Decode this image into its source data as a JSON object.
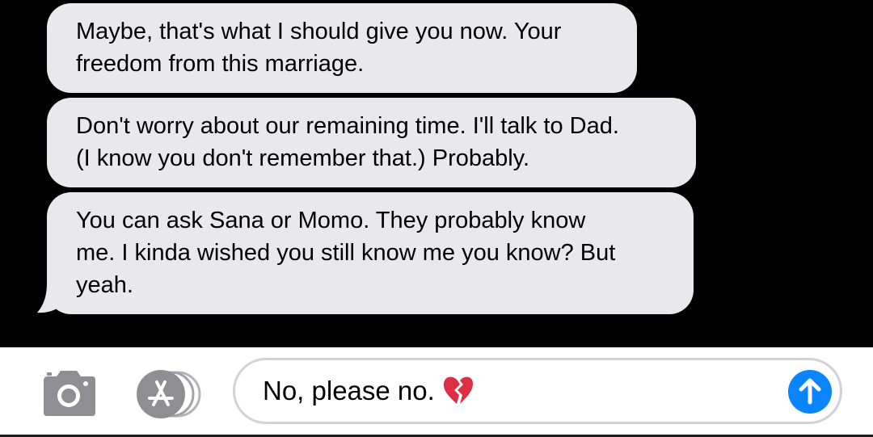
{
  "thread": {
    "messages": [
      {
        "sender": "received",
        "text": "Maybe, that's what I should give you now. Your\nfreedom from this marriage."
      },
      {
        "sender": "received",
        "text": "Don't worry about our remaining time. I'll talk to Dad.\n(I know you don't remember that.) Probably."
      },
      {
        "sender": "received",
        "text": "You can ask Sana or Momo. They probably know\nme. I kinda wished you still know me you know? But\nyeah."
      }
    ]
  },
  "input_bar": {
    "camera_icon": "camera-icon",
    "apps_icon": "app-store-icon",
    "field_value": "No, please no.",
    "emoji_icon": "broken-heart-emoji",
    "send_icon": "arrow-up-icon"
  },
  "colors": {
    "received_bubble": "#e9e9eb",
    "send_button": "#0a84ff",
    "thread_background": "#000000",
    "icon_gray": "#8e8e93"
  }
}
